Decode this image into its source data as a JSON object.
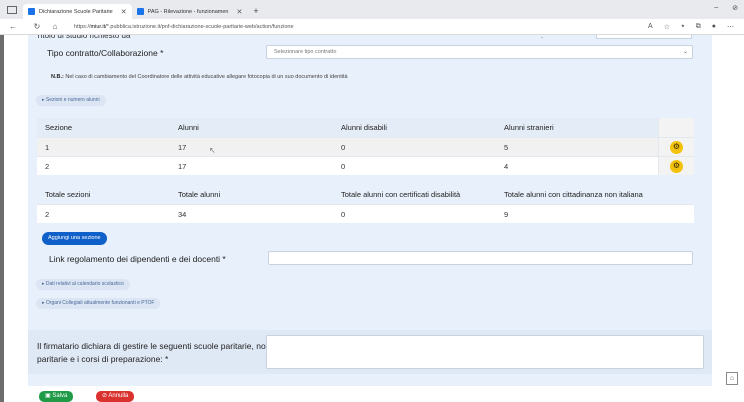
{
  "browser": {
    "tabs": [
      {
        "title": "Dichiarazione Scuole Paritarie",
        "active": true
      },
      {
        "title": "PAG - Rilevazione - funzionamen",
        "active": false
      }
    ],
    "url_prefix": "https://",
    "url_host": "miur.it/",
    "url_path": "*.pubblica.istruzione.it/pnf-dichiarazione-scuole-paritarie-web/action/funzione"
  },
  "form": {
    "cut_label": "Titolo di studio richiesto da",
    "contract_label": "Tipo contratto/Collaborazione *",
    "contract_placeholder": "Selezionare tipo contratto",
    "note_bold": "N.B.:",
    "note_text": "Nel caso di cambiamento del Coordinatore delle attività educative allegare fotocopia di un suo documento di identità",
    "sections_toggle": "Sezioni e numero alunni",
    "sections_table": {
      "headers": [
        "Sezione",
        "Alunni",
        "Alunni disabili",
        "Alunni stranieri"
      ],
      "rows": [
        [
          "1",
          "17",
          "0",
          "5"
        ],
        [
          "2",
          "17",
          "0",
          "4"
        ]
      ]
    },
    "totals_table": {
      "headers": [
        "Totale sezioni",
        "Totale alunni",
        "Totale alunni con certificati disabilità",
        "Totale alunni con cittadinanza non italiana"
      ],
      "values": [
        "2",
        "34",
        "0",
        "9"
      ]
    },
    "add_section_label": "Aggiungi una sezione",
    "link_label": "Link regolamento dei dipendenti e dei docenti *",
    "calendar_toggle": "Dati relativi al calendario scolastico",
    "collegial_toggle": "Organi Collegiali attualmente funzionanti e PTOF",
    "signatory_label_1": "Il firmatario dichiara di gestire le seguenti scuole paritarie, non",
    "signatory_label_2": "paritarie e i corsi di preparazione: *",
    "save_label": "Salva",
    "cancel_label": "Annulla"
  },
  "colors": {
    "form_bg": "#e8f0fb",
    "primary": "#1060c9",
    "save": "#1f9a47",
    "cancel": "#d9322f",
    "action_icon": "#f2c20c"
  }
}
